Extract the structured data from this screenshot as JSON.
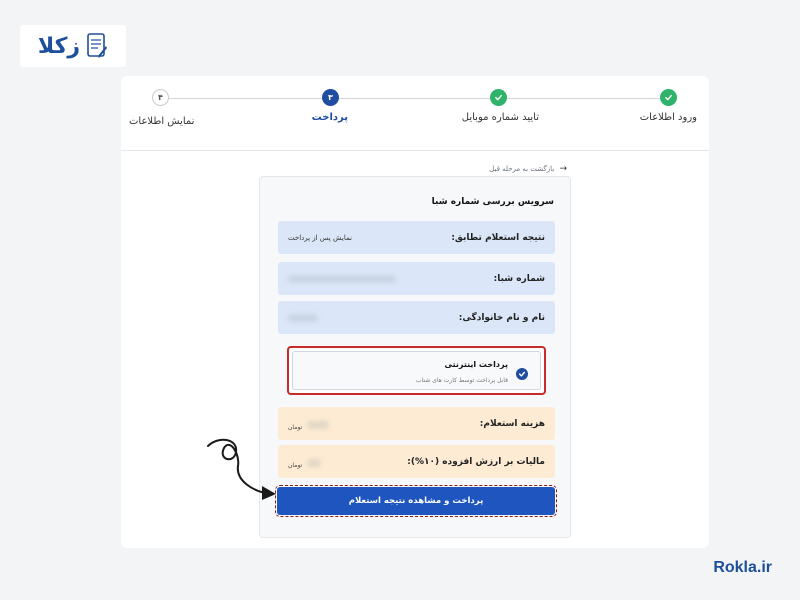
{
  "brand": {
    "logo_text": "زکلا",
    "footer": "Rokla.ir"
  },
  "stepper": {
    "steps": [
      {
        "label": "ورود اطلاعات",
        "state": "done",
        "number": ""
      },
      {
        "label": "تایید شماره موبایل",
        "state": "done",
        "number": ""
      },
      {
        "label": "پرداخت",
        "state": "active",
        "number": "۳"
      },
      {
        "label": "نمایش اطلاعات",
        "state": "todo",
        "number": "۴"
      }
    ]
  },
  "back_link": "بازگشت به مرحله قبل",
  "panel": {
    "title": "سرویس بررسی شماره شبا",
    "rows": [
      {
        "label": "نتیجه استعلام تطابق:",
        "value": "نمایش پس از پرداخت"
      },
      {
        "label": "شماره شبا:",
        "value": ""
      },
      {
        "label": "نام و نام خانوادگی:",
        "value": ""
      }
    ],
    "payment_method": {
      "title": "پرداخت اینترنتی",
      "subtitle": "قابل پرداخت توسط کارت های شتاب"
    },
    "costs": [
      {
        "label": "هزینه استعلام:",
        "unit": "تومان"
      },
      {
        "label": "مالیات بر ارزش افزوده (۱۰%):",
        "unit": "تومان"
      }
    ],
    "submit_label": "پرداخت و مشاهده نتیجه استعلام"
  },
  "colors": {
    "brand_blue": "#1f4da0",
    "success_green": "#2fb36b",
    "highlight_red": "#c92a2a",
    "button_blue": "#1f55bf"
  }
}
